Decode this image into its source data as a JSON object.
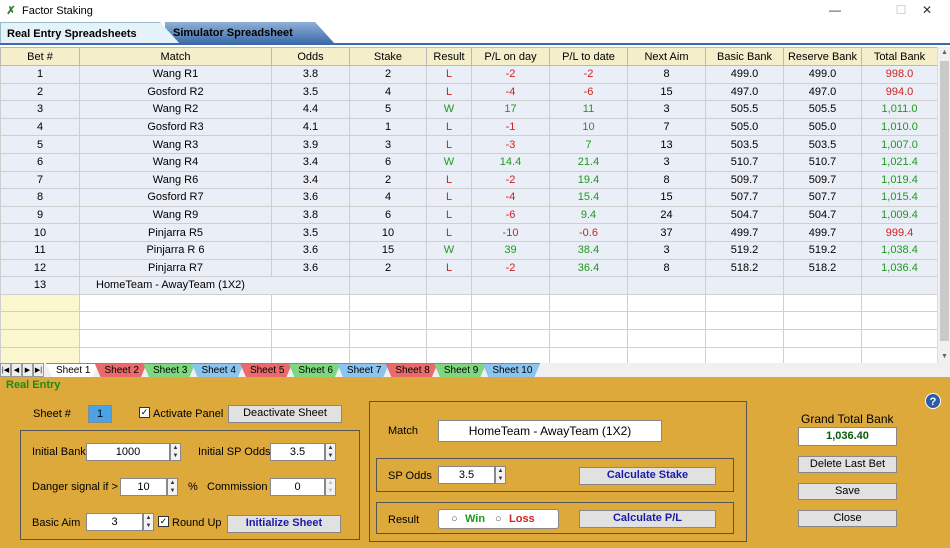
{
  "window": {
    "title": "Factor Staking",
    "minimize": "—",
    "maximize": "☐",
    "close": "✕"
  },
  "top_tabs": {
    "real": "Real Entry Spreadsheets",
    "sim": "Simulator Spreadsheet"
  },
  "columns": [
    "Bet #",
    "Match",
    "Odds",
    "Stake",
    "Result",
    "P/L on day",
    "P/L to date",
    "Next Aim",
    "Basic Bank",
    "Reserve Bank",
    "Total Bank"
  ],
  "rows": [
    [
      "1",
      "Wang R1",
      "3.8",
      "2",
      "L",
      "-2",
      "-2",
      "8",
      "499.0",
      "499.0",
      "998.0"
    ],
    [
      "2",
      "Gosford R2",
      "3.5",
      "4",
      "L",
      "-4",
      "-6",
      "15",
      "497.0",
      "497.0",
      "994.0"
    ],
    [
      "3",
      "Wang R2",
      "4.4",
      "5",
      "W",
      "17",
      "11",
      "3",
      "505.5",
      "505.5",
      "1,011.0"
    ],
    [
      "4",
      "Gosford R3",
      "4.1",
      "1",
      "L",
      "-1",
      "10",
      "7",
      "505.0",
      "505.0",
      "1,010.0"
    ],
    [
      "5",
      "Wang R3",
      "3.9",
      "3",
      "L",
      "-3",
      "7",
      "13",
      "503.5",
      "503.5",
      "1,007.0"
    ],
    [
      "6",
      "Wang R4",
      "3.4",
      "6",
      "W",
      "14.4",
      "21.4",
      "3",
      "510.7",
      "510.7",
      "1,021.4"
    ],
    [
      "7",
      "Wang R6",
      "3.4",
      "2",
      "L",
      "-2",
      "19.4",
      "8",
      "509.7",
      "509.7",
      "1,019.4"
    ],
    [
      "8",
      "Gosford R7",
      "3.6",
      "4",
      "L",
      "-4",
      "15.4",
      "15",
      "507.7",
      "507.7",
      "1,015.4"
    ],
    [
      "9",
      "Wang R9",
      "3.8",
      "6",
      "L",
      "-6",
      "9.4",
      "24",
      "504.7",
      "504.7",
      "1,009.4"
    ],
    [
      "10",
      "Pinjarra R5",
      "3.5",
      "10",
      "L",
      "-10",
      "-0.6",
      "37",
      "499.7",
      "499.7",
      "999.4"
    ],
    [
      "11",
      "Pinjarra R 6",
      "3.6",
      "15",
      "W",
      "39",
      "38.4",
      "3",
      "519.2",
      "519.2",
      "1,038.4"
    ],
    [
      "12",
      "Pinjarra R7",
      "3.6",
      "2",
      "L",
      "-2",
      "36.4",
      "8",
      "518.2",
      "518.2",
      "1,036.4"
    ]
  ],
  "pending_row": {
    "bet": "13",
    "match": "HomeTeam - AwayTeam (1X2)"
  },
  "sheet_tabs": [
    "Sheet 1",
    "Sheet 2",
    "Sheet 3",
    "Sheet 4",
    "Sheet 5",
    "Sheet 6",
    "Sheet 7",
    "Sheet 8",
    "Sheet 9",
    "Sheet 10"
  ],
  "sheet_tab_colors": [
    "#ffffff",
    "#e86a6a",
    "#7fd67f",
    "#8cc4f0",
    "#e86a6a",
    "#7fd67f",
    "#8cc4f0",
    "#e86a6a",
    "#7fd67f",
    "#8cc4f0"
  ],
  "panel": {
    "title": "Real Entry",
    "sheet_label": "Sheet #",
    "sheet_value": "1",
    "activate_label": "Activate Panel",
    "deactivate_button": "Deactivate Sheet",
    "initial_bank_label": "Initial Bank",
    "initial_bank": "1000",
    "initial_sp_odds_label": "Initial SP Odds",
    "initial_sp_odds": "3.5",
    "danger_label": "Danger signal if >",
    "danger_value": "10",
    "percent": "%",
    "commission_label": "Commission",
    "commission_value": "0",
    "basic_aim_label": "Basic Aim",
    "basic_aim": "3",
    "round_up_label": "Round Up",
    "initialize_button": "Initialize Sheet",
    "match_label": "Match",
    "match_value": "HomeTeam - AwayTeam (1X2)",
    "sp_odds_label": "SP Odds",
    "sp_odds_value": "3.5",
    "calc_stake_button": "Calculate Stake",
    "result_label": "Result",
    "win_label": "Win",
    "loss_label": "Loss",
    "calc_pl_button": "Calculate P/L",
    "grand_total_label": "Grand Total Bank",
    "grand_total_value": "1,036.40",
    "delete_last_button": "Delete Last Bet",
    "save_button": "Save",
    "close_button": "Close"
  },
  "colors": {
    "accent": "#dca93a",
    "loss": "#d32020",
    "win": "#1e9a1e"
  }
}
